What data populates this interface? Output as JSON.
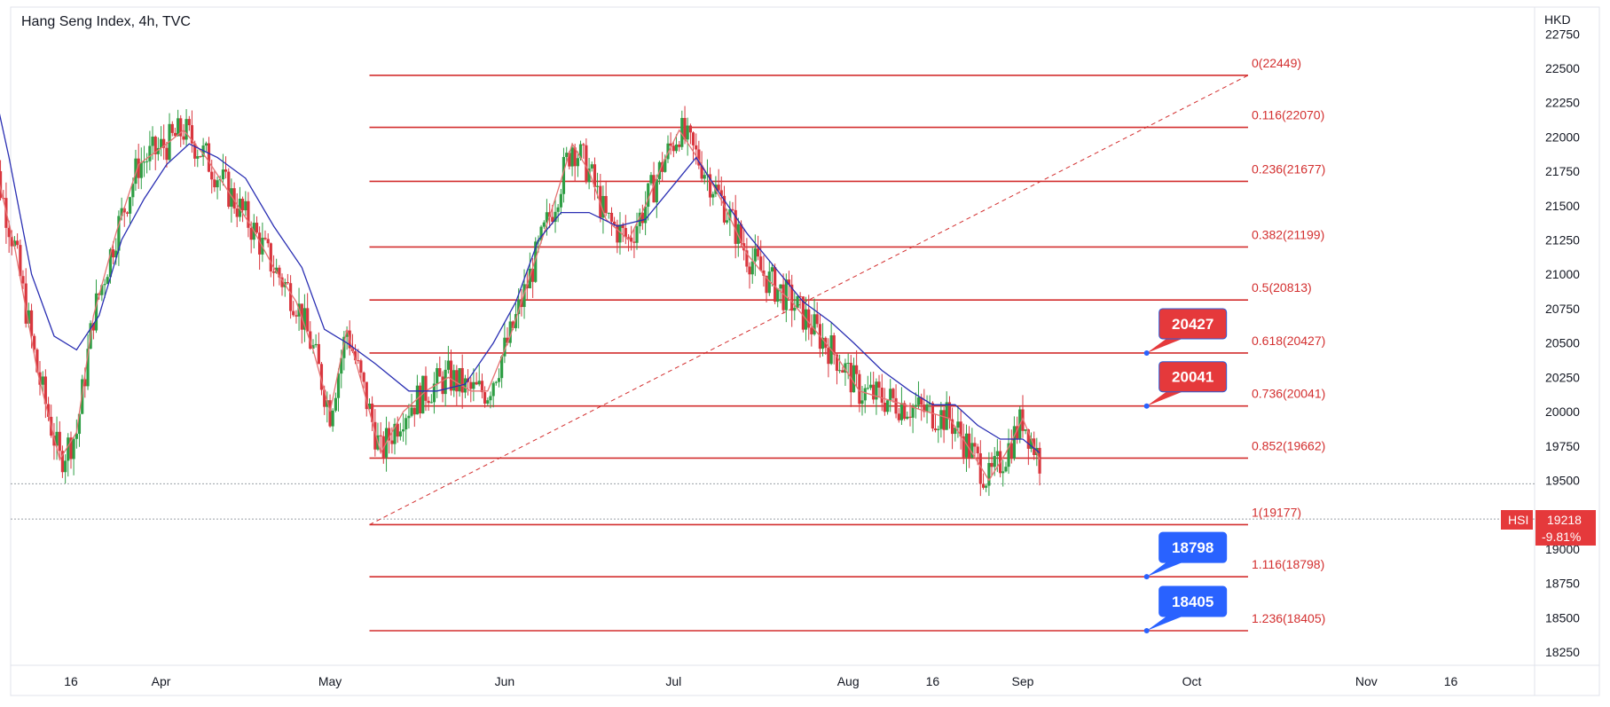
{
  "header": {
    "title": "Hang Seng Index, 4h, TVC"
  },
  "colors": {
    "up": "#2e9e44",
    "down": "#d9363e",
    "fib_line": "#d32f2f",
    "ma_fast": "#e57373",
    "ma_slow": "#2a2fb3",
    "callout_red": "#e5393b",
    "callout_blue": "#2962ff",
    "price_tag": "#e5393b"
  },
  "chart_data": {
    "type": "candlestick",
    "currency": "HKD",
    "symbol": "HSI",
    "last_price": "19218",
    "change": "-9.81%",
    "ylim": [
      18100,
      22800
    ],
    "y_ticks": [
      "22750",
      "22500",
      "22250",
      "22000",
      "21750",
      "21500",
      "21250",
      "21000",
      "20750",
      "20500",
      "20250",
      "20000",
      "19750",
      "19500",
      "19250",
      "19000",
      "18750",
      "18500",
      "18250"
    ],
    "x_ticks": [
      {
        "label": "16",
        "date": "2024-03-16"
      },
      {
        "label": "Apr",
        "date": "2024-04-01"
      },
      {
        "label": "May",
        "date": "2024-05-01"
      },
      {
        "label": "Jun",
        "date": "2024-06-01"
      },
      {
        "label": "Jul",
        "date": "2024-07-01"
      },
      {
        "label": "Aug",
        "date": "2024-08-01"
      },
      {
        "label": "16",
        "date": "2024-08-16"
      },
      {
        "label": "Sep",
        "date": "2024-09-01"
      },
      {
        "label": "Oct",
        "date": "2024-10-01"
      },
      {
        "label": "Nov",
        "date": "2024-11-01"
      },
      {
        "label": "16",
        "date": "2024-11-16"
      }
    ],
    "fib_levels": [
      {
        "ratio": "0",
        "value": 22449,
        "label": "0(22449)"
      },
      {
        "ratio": "0.116",
        "value": 22070,
        "label": "0.116(22070)"
      },
      {
        "ratio": "0.236",
        "value": 21677,
        "label": "0.236(21677)"
      },
      {
        "ratio": "0.382",
        "value": 21199,
        "label": "0.382(21199)"
      },
      {
        "ratio": "0.5",
        "value": 20813,
        "label": "0.5(20813)"
      },
      {
        "ratio": "0.618",
        "value": 20427,
        "label": "0.618(20427)"
      },
      {
        "ratio": "0.736",
        "value": 20041,
        "label": "0.736(20041)"
      },
      {
        "ratio": "0.852",
        "value": 19662,
        "label": "0.852(19662)"
      },
      {
        "ratio": "1",
        "value": 19177,
        "label": "1(19177)"
      },
      {
        "ratio": "1.116",
        "value": 18798,
        "label": "1.116(18798)"
      },
      {
        "ratio": "1.236",
        "value": 18405,
        "label": "1.236(18405)"
      }
    ],
    "fib_start_date": "2024-05-08",
    "fib_end_date": "2024-10-11",
    "trend_line": {
      "from": {
        "date": "2024-05-08",
        "value": 19177
      },
      "to": {
        "date": "2024-10-11",
        "value": 22449
      }
    },
    "callouts": [
      {
        "text": "20427",
        "value": 20427,
        "date": "2024-09-23",
        "color": "red"
      },
      {
        "text": "20041",
        "value": 20041,
        "date": "2024-09-23",
        "color": "red"
      },
      {
        "text": "18798",
        "value": 18798,
        "date": "2024-09-23",
        "color": "blue"
      },
      {
        "text": "18405",
        "value": 18405,
        "date": "2024-09-23",
        "color": "blue"
      }
    ],
    "dotted_levels": [
      19475,
      19218
    ],
    "ma_fast": [
      [
        "2024-03-01",
        22050
      ],
      [
        "2024-03-06",
        21200
      ],
      [
        "2024-03-10",
        20300
      ],
      [
        "2024-03-14",
        19650
      ],
      [
        "2024-03-17",
        19850
      ],
      [
        "2024-03-20",
        20700
      ],
      [
        "2024-03-24",
        21300
      ],
      [
        "2024-03-28",
        21800
      ],
      [
        "2024-04-02",
        21950
      ],
      [
        "2024-04-05",
        22050
      ],
      [
        "2024-04-09",
        21850
      ],
      [
        "2024-04-13",
        21600
      ],
      [
        "2024-04-17",
        21350
      ],
      [
        "2024-04-21",
        21050
      ],
      [
        "2024-04-25",
        20800
      ],
      [
        "2024-04-28",
        20450
      ],
      [
        "2024-05-01",
        20000
      ],
      [
        "2024-05-04",
        20600
      ],
      [
        "2024-05-07",
        20150
      ],
      [
        "2024-05-10",
        19700
      ],
      [
        "2024-05-14",
        20000
      ],
      [
        "2024-05-18",
        20150
      ],
      [
        "2024-05-22",
        20250
      ],
      [
        "2024-05-26",
        20150
      ],
      [
        "2024-05-29",
        20150
      ],
      [
        "2024-06-02",
        20550
      ],
      [
        "2024-06-06",
        21050
      ],
      [
        "2024-06-10",
        21550
      ],
      [
        "2024-06-13",
        21950
      ],
      [
        "2024-06-16",
        21750
      ],
      [
        "2024-06-19",
        21400
      ],
      [
        "2024-06-23",
        21250
      ],
      [
        "2024-06-26",
        21500
      ],
      [
        "2024-06-29",
        21800
      ],
      [
        "2024-07-02",
        22050
      ],
      [
        "2024-07-06",
        21800
      ],
      [
        "2024-07-10",
        21500
      ],
      [
        "2024-07-14",
        21150
      ],
      [
        "2024-07-18",
        20950
      ],
      [
        "2024-07-22",
        20800
      ],
      [
        "2024-07-26",
        20600
      ],
      [
        "2024-07-30",
        20400
      ],
      [
        "2024-08-03",
        20150
      ],
      [
        "2024-08-07",
        20100
      ],
      [
        "2024-08-11",
        20050
      ],
      [
        "2024-08-15",
        20000
      ],
      [
        "2024-08-19",
        19950
      ],
      [
        "2024-08-23",
        19700
      ],
      [
        "2024-08-26",
        19500
      ],
      [
        "2024-08-29",
        19700
      ],
      [
        "2024-09-01",
        19950
      ],
      [
        "2024-09-04",
        19650
      ]
    ],
    "ma_slow": [
      [
        "2024-03-01",
        22600
      ],
      [
        "2024-03-05",
        21850
      ],
      [
        "2024-03-09",
        21000
      ],
      [
        "2024-03-13",
        20550
      ],
      [
        "2024-03-17",
        20450
      ],
      [
        "2024-03-21",
        20700
      ],
      [
        "2024-03-25",
        21250
      ],
      [
        "2024-03-29",
        21550
      ],
      [
        "2024-04-02",
        21800
      ],
      [
        "2024-04-06",
        21950
      ],
      [
        "2024-04-11",
        21850
      ],
      [
        "2024-04-16",
        21700
      ],
      [
        "2024-04-21",
        21350
      ],
      [
        "2024-04-26",
        21050
      ],
      [
        "2024-04-30",
        20600
      ],
      [
        "2024-05-04",
        20500
      ],
      [
        "2024-05-09",
        20350
      ],
      [
        "2024-05-15",
        20150
      ],
      [
        "2024-05-20",
        20150
      ],
      [
        "2024-05-25",
        20200
      ],
      [
        "2024-05-30",
        20500
      ],
      [
        "2024-06-03",
        20800
      ],
      [
        "2024-06-07",
        21250
      ],
      [
        "2024-06-11",
        21450
      ],
      [
        "2024-06-16",
        21450
      ],
      [
        "2024-06-21",
        21350
      ],
      [
        "2024-06-26",
        21400
      ],
      [
        "2024-07-01",
        21650
      ],
      [
        "2024-07-05",
        21850
      ],
      [
        "2024-07-09",
        21600
      ],
      [
        "2024-07-14",
        21300
      ],
      [
        "2024-07-19",
        21050
      ],
      [
        "2024-07-24",
        20800
      ],
      [
        "2024-07-29",
        20650
      ],
      [
        "2024-08-02",
        20500
      ],
      [
        "2024-08-07",
        20300
      ],
      [
        "2024-08-12",
        20150
      ],
      [
        "2024-08-16",
        20050
      ],
      [
        "2024-08-20",
        20050
      ],
      [
        "2024-08-24",
        19900
      ],
      [
        "2024-08-28",
        19800
      ],
      [
        "2024-09-01",
        19800
      ],
      [
        "2024-09-04",
        19700
      ]
    ]
  }
}
